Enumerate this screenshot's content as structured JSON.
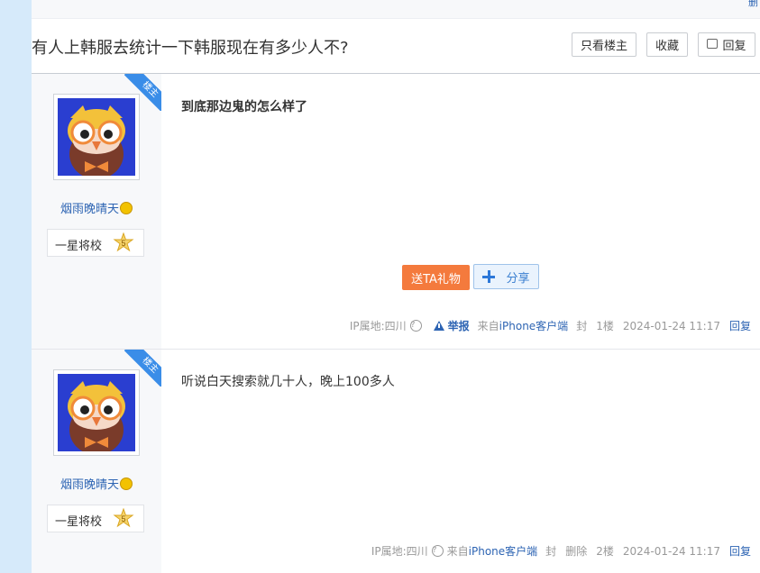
{
  "top_strip": {
    "text": "删"
  },
  "thread": {
    "title": "有人上韩服去统计一下韩服现在有多少人不?",
    "buttons": {
      "only_op": "只看楼主",
      "favorite": "收藏",
      "reply": "回复"
    }
  },
  "posts": [
    {
      "badge": "楼主",
      "author": "烟雨晚晴天",
      "rank_title": "一星将校",
      "level": "5",
      "content": "到底那边鬼的怎么样了",
      "gift_label": "送TA礼物",
      "share_label": "分享",
      "ip_location": "IP属地:四川",
      "report_label": "举报",
      "client_prefix": "来自",
      "client_name": "iPhone客户端",
      "block_label": "封",
      "floor": "1楼",
      "timestamp": "2024-01-24 11:17",
      "reply_label": "回复"
    },
    {
      "badge": "楼主",
      "author": "烟雨晚晴天",
      "rank_title": "一星将校",
      "level": "5",
      "content": "听说白天搜索就几十人，晚上100多人",
      "ip_location": "IP属地:四川",
      "client_prefix": "来自",
      "client_name": "iPhone客户端",
      "block_label": "封",
      "delete_label": "删除",
      "floor": "2楼",
      "timestamp": "2024-01-24 11:17",
      "reply_label": "回复"
    }
  ],
  "colors": {
    "link": "#2d64b3",
    "gift": "#f47a3d",
    "badge": "#3a8de8",
    "rail": "#d6eafa"
  }
}
